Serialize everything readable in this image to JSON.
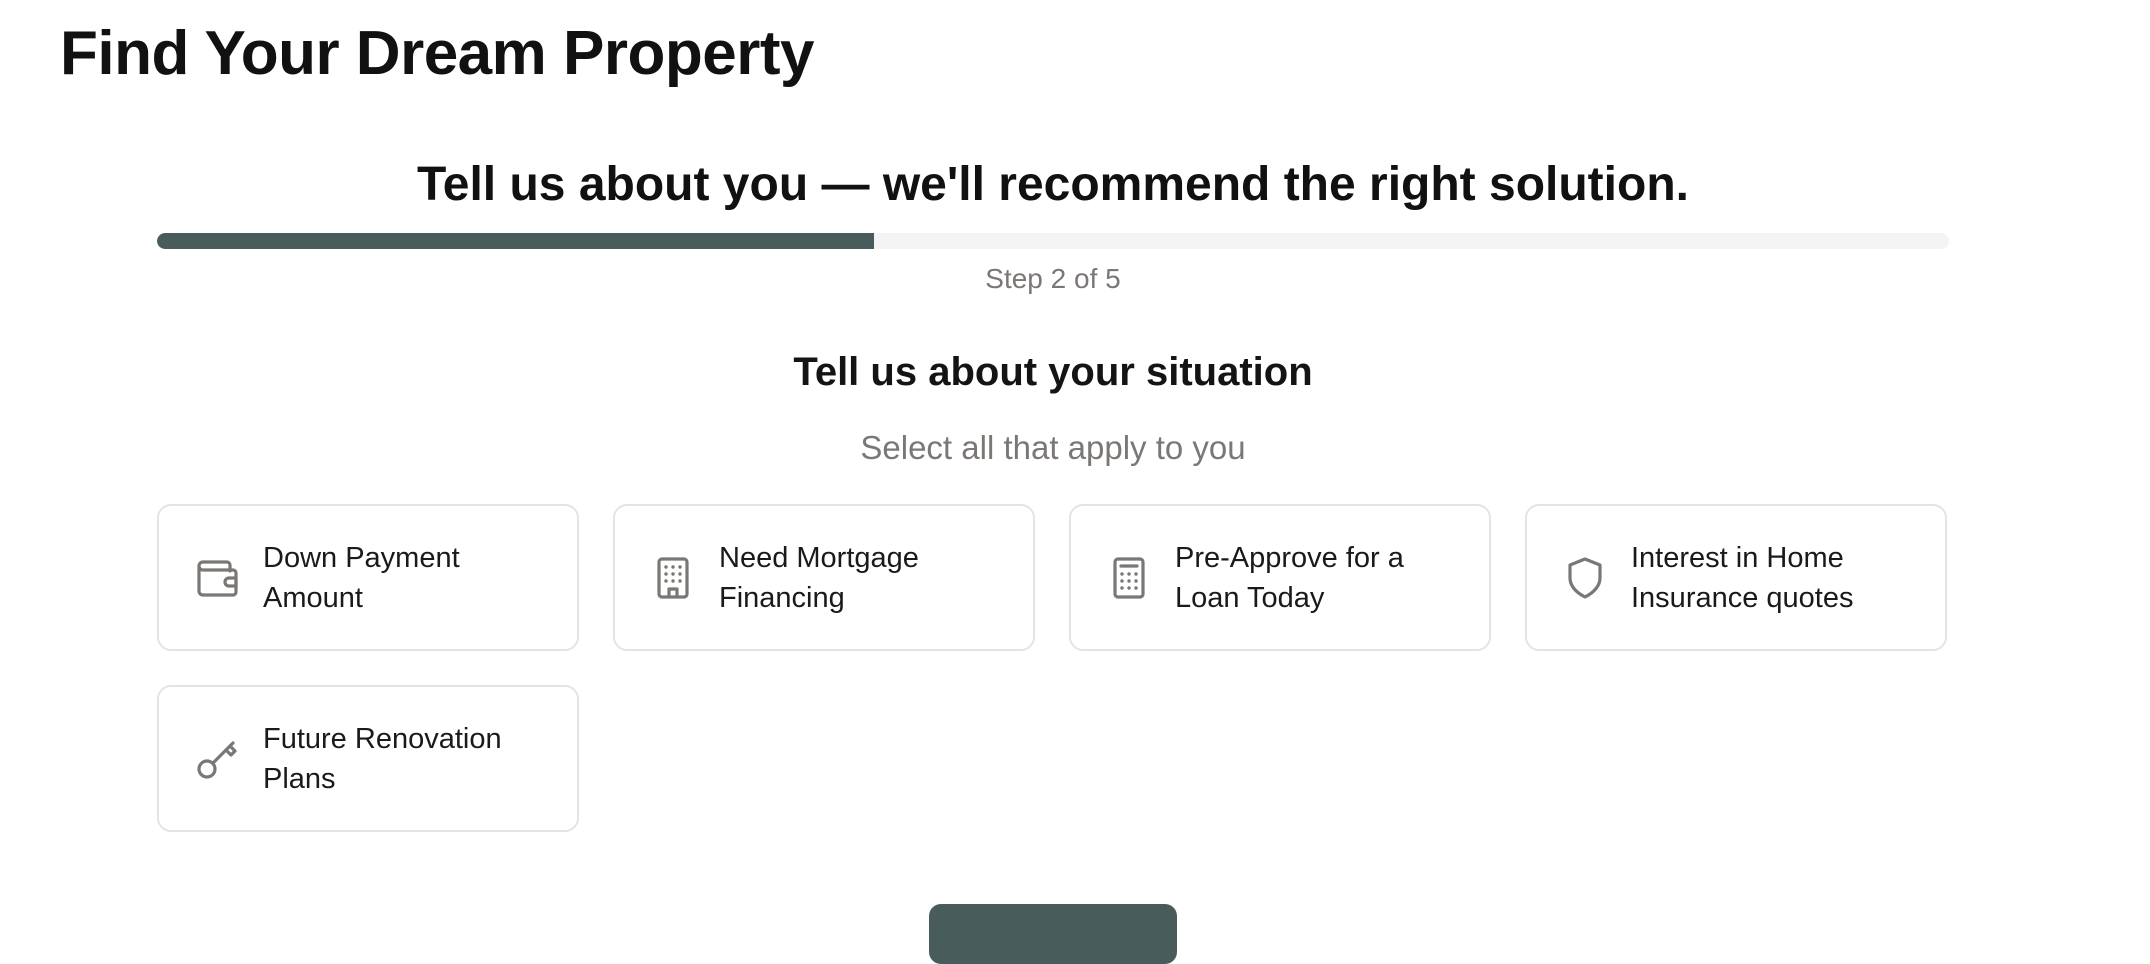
{
  "page": {
    "title": "Find Your Dream Property"
  },
  "wizard": {
    "heading": "Tell us about you — we'll recommend the right solution.",
    "progress": {
      "current_step": 2,
      "total_steps": 5,
      "fraction_complete": 0.4,
      "label": "Step 2 of 5",
      "fill_color": "#485c5c",
      "track_color": "#f4f4f4"
    },
    "section": {
      "heading": "Tell us about your situation",
      "subtitle": "Select all that apply to you"
    },
    "options": [
      {
        "label": "Down Payment Amount",
        "icon": "wallet-icon",
        "selected": false
      },
      {
        "label": "Need Mortgage Financing",
        "icon": "building-icon",
        "selected": false
      },
      {
        "label": "Pre-Approve for a Loan Today",
        "icon": "calculator-icon",
        "selected": false
      },
      {
        "label": "Interest in Home Insurance quotes",
        "icon": "shield-icon",
        "selected": false
      },
      {
        "label": "Future Renovation Plans",
        "icon": "key-icon",
        "selected": false
      }
    ],
    "continue_button": {
      "label": "",
      "color": "#485c5c"
    }
  },
  "colors": {
    "heading_text": "#111111",
    "muted_text": "#7a7775",
    "icon": "#7a7775",
    "card_border": "#e4e4e4"
  }
}
